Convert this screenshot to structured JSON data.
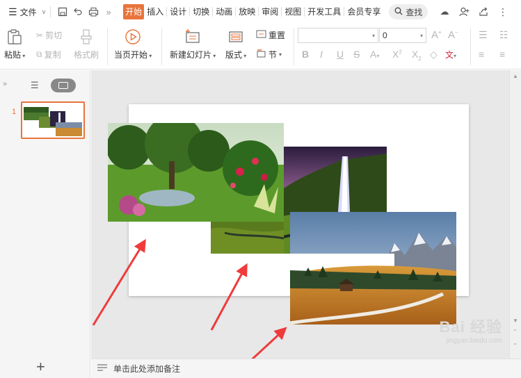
{
  "menu": {
    "file_label": "文件",
    "tabs": [
      {
        "label": "开始",
        "active": true
      },
      {
        "label": "插入",
        "active": false
      },
      {
        "label": "设计",
        "active": false
      },
      {
        "label": "切换",
        "active": false
      },
      {
        "label": "动画",
        "active": false
      },
      {
        "label": "放映",
        "active": false
      },
      {
        "label": "审阅",
        "active": false
      },
      {
        "label": "视图",
        "active": false
      },
      {
        "label": "开发工具",
        "active": false
      },
      {
        "label": "会员专享",
        "active": false
      }
    ],
    "search_label": "查找"
  },
  "ribbon": {
    "paste": "粘贴",
    "cut": "剪切",
    "copy": "复制",
    "format_painter": "格式刷",
    "play_from_current": "当页开始",
    "new_slide": "新建幻灯片",
    "layout": "版式",
    "reset": "重置",
    "section": "节",
    "font_size_value": "0",
    "font_name_value": ""
  },
  "slides_panel": {
    "slide_number": "1"
  },
  "notes": {
    "placeholder": "单击此处添加备注"
  },
  "watermark": {
    "title": "Bai 经验",
    "url": "jingyan.baidu.com"
  },
  "colors": {
    "accent": "#e8743b",
    "arrow": "#ef3b3b"
  }
}
